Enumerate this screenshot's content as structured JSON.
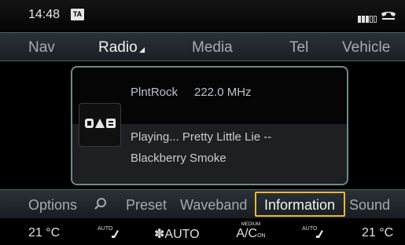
{
  "status": {
    "time": "14:48",
    "ta": "TA"
  },
  "main_menu": {
    "nav": "Nav",
    "radio": "Radio",
    "media": "Media",
    "tel": "Tel",
    "vehicle": "Vehicle"
  },
  "panel": {
    "station": "PlntRock",
    "frequency": "222.0 MHz",
    "now_playing_line1": "Playing... Pretty Little Lie --",
    "now_playing_line2": "Blackberry Smoke",
    "source_logo": "DAB"
  },
  "sub_menu": {
    "options": "Options",
    "preset": "Preset",
    "waveband": "Waveband",
    "information": "Information",
    "sound": "Sound"
  },
  "climate": {
    "left_temp": "21 °C",
    "right_temp": "21 °C",
    "left_auto": "AUTO",
    "right_auto": "AUTO",
    "fan_label": "AUTO",
    "ac_medium": "MEDIUM",
    "ac_label": "A/C",
    "ac_on": "ON"
  },
  "colors": {
    "accent_focus": "#e8b83a",
    "divider": "#3d6a69"
  },
  "icons": [
    "phone-icon",
    "signal-bars-icon",
    "search-icon",
    "seat-heat-icon",
    "fan-icon",
    "dab-logo-icon"
  ]
}
